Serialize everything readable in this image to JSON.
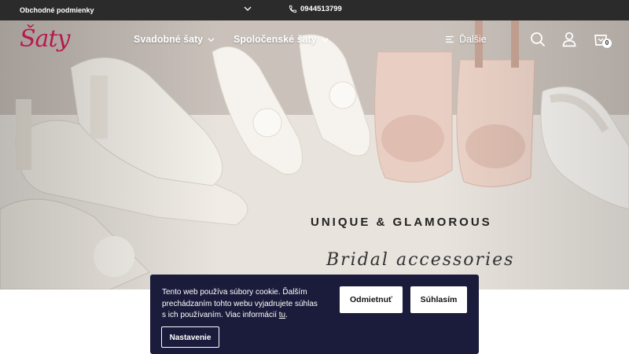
{
  "topbar": {
    "terms_link": "Obchodné podmienky",
    "phone": "0944513799"
  },
  "brand": {
    "logo": "Šaty",
    "color": "#b8184f"
  },
  "nav": {
    "items": [
      {
        "label": "Svadobné šaty"
      },
      {
        "label": "Spoločenské šaty"
      }
    ],
    "more_label": "Ďalšie",
    "cart_count": "0",
    "icons": [
      "search-icon",
      "user-icon",
      "cart-icon",
      "menu-icon",
      "chevron-down-icon",
      "phone-icon"
    ]
  },
  "hero": {
    "tagline": "UNIQUE & GLAMOROUS",
    "script_text": "Bridal accessories"
  },
  "cookie": {
    "text": "Tento web používa súbory cookie. Ďalším prechádzaním tohto webu vyjadrujete súhlas s ich používaním. Viac informácií ",
    "link_text": "tu",
    "text_end": ".",
    "reject_label": "Odmietnuť",
    "accept_label": "Súhlasím",
    "settings_label": "Nastavenie",
    "bg_color": "#1b1c3b"
  }
}
